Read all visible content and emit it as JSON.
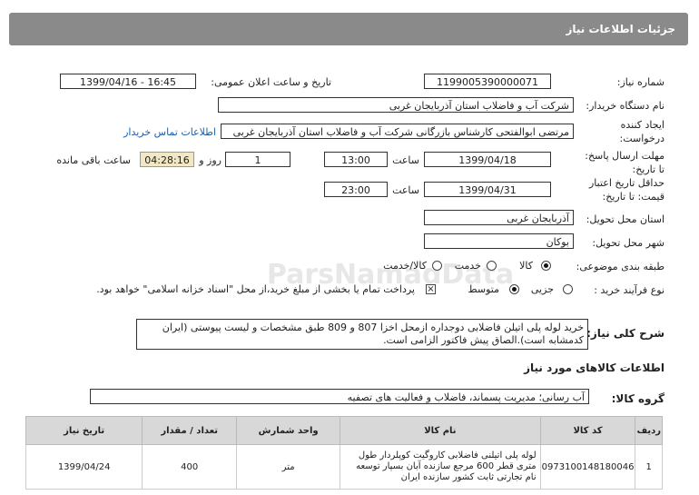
{
  "page": {
    "title": "جزئیات اطلاعات نیاز"
  },
  "fields": {
    "need_number_label": "شماره نیاز:",
    "need_number": "1199005390000071",
    "announce_label": "تاریخ و ساعت اعلان عمومی:",
    "announce_value": "1399/04/16 - 16:45",
    "buyer_label": "نام دستگاه خریدار:",
    "buyer_value": "شرکت آب و فاضلاب استان آذربایجان غربی",
    "creator_label_1": "ایجاد کننده",
    "creator_label_2": "درخواست:",
    "creator_value": "مرتضی ابوالفتحی کارشناس بازرگانی شرکت آب و فاضلاب استان آذربایجان غربی",
    "contact_link": "اطلاعات تماس خریدار",
    "reply_label_1": "مهلت ارسال پاسخ:",
    "reply_label_2": "تا تاریخ:",
    "reply_date": "1399/04/18",
    "time_label": "ساعت",
    "reply_time": "13:00",
    "days_value": "1",
    "days_label": "روز و",
    "remaining_time": "04:28:16",
    "remaining_label": "ساعت باقی مانده",
    "validity_label_1": "حداقل تاریخ اعتبار",
    "validity_label_2": "قیمت: تا تاریخ:",
    "validity_date": "1399/04/31",
    "validity_time_label": "ساعت",
    "validity_time": "23:00",
    "province_label": "استان محل تحویل:",
    "province_value": "آذربایجان غربی",
    "city_label": "شهر محل تحویل:",
    "city_value": "بوکان",
    "category_label": "طبقه بندی موضوعی:",
    "category_options": [
      "کالا",
      "خدمت",
      "کالا/خدمت"
    ],
    "category_selected": "کالا",
    "process_label": "نوع فرآیند خرید :",
    "process_options": [
      "جزیی",
      "متوسط"
    ],
    "process_selected": "متوسط",
    "payment_note": "پرداخت تمام یا بخشی از مبلغ خرید،از محل \"اسناد خزانه اسلامی\" خواهد بود.",
    "payment_checked": true
  },
  "description": {
    "label": "شرح کلی نیاز:",
    "text": "خرید لوله پلی اتیلن فاضلابی دوجداره ازمحل اخزا 807 و 809  طبق مشخصات و لیست پیوستی (ایران کدمشابه است).الصاق پیش فاکتور الزامی است."
  },
  "goods_section": {
    "title": "اطلاعات کالاهای مورد نیاز",
    "group_label": "گروه کالا:",
    "group_value": "آب رسانی؛ مدیریت پسماند، فاضلاب و فعالیت های تصفیه"
  },
  "table": {
    "headers": [
      "ردیف",
      "کد کالا",
      "نام کالا",
      "واحد شمارش",
      "تعداد / مقدار",
      "تاریخ نیاز"
    ],
    "rows": [
      {
        "row": "1",
        "code": "0973100148180046",
        "name": "لوله پلی اتیلنی فاضلابی کاروگیت کوپلردار طول متری قطر 600 مرجع سازنده آبان بسپار توسعه نام تجارتی ثابت کشور سازنده ایران",
        "unit": "متر",
        "qty": "400",
        "date": "1399/04/24"
      }
    ]
  },
  "watermark": {
    "line1": "ParsNamadData"
  }
}
